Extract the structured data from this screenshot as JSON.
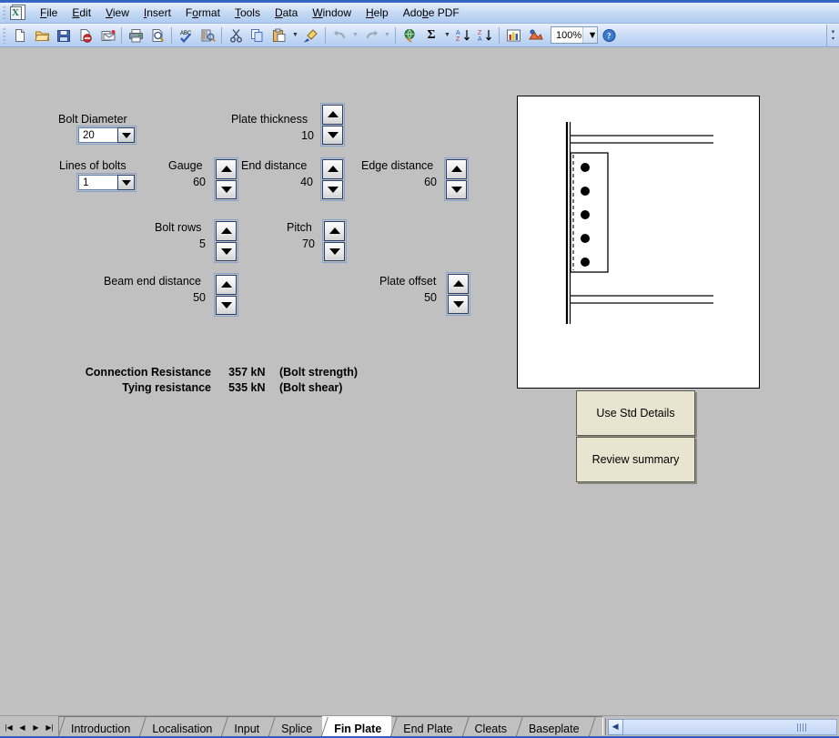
{
  "app": {
    "icon": "excel-icon",
    "menus": [
      {
        "label": "File",
        "accel": "F"
      },
      {
        "label": "Edit",
        "accel": "E"
      },
      {
        "label": "View",
        "accel": "V"
      },
      {
        "label": "Insert",
        "accel": "I"
      },
      {
        "label": "Format",
        "accel": "o"
      },
      {
        "label": "Tools",
        "accel": "T"
      },
      {
        "label": "Data",
        "accel": "D"
      },
      {
        "label": "Window",
        "accel": "W"
      },
      {
        "label": "Help",
        "accel": "H"
      },
      {
        "label": "Adobe PDF",
        "accel": "b"
      }
    ]
  },
  "toolbar": {
    "zoom_value": "100%",
    "buttons": [
      {
        "name": "new-icon"
      },
      {
        "name": "open-icon"
      },
      {
        "name": "save-icon"
      },
      {
        "name": "permission-icon"
      },
      {
        "name": "email-icon"
      },
      {
        "name": "print-icon"
      },
      {
        "name": "print-preview-icon"
      },
      {
        "name": "spelling-icon"
      },
      {
        "name": "research-icon"
      },
      {
        "name": "cut-icon"
      },
      {
        "name": "copy-icon"
      },
      {
        "name": "paste-icon"
      },
      {
        "name": "format-painter-icon"
      },
      {
        "name": "undo-icon"
      },
      {
        "name": "redo-icon"
      },
      {
        "name": "hyperlink-icon"
      },
      {
        "name": "autosum-icon"
      },
      {
        "name": "sort-ascending-icon"
      },
      {
        "name": "sort-descending-icon"
      },
      {
        "name": "chart-wizard-icon"
      },
      {
        "name": "drawing-icon"
      },
      {
        "name": "help-icon"
      }
    ]
  },
  "form": {
    "bolt_diameter": {
      "label": "Bolt Diameter",
      "value": "20"
    },
    "lines_of_bolts": {
      "label": "Lines of bolts",
      "value": "1"
    },
    "plate_thickness": {
      "label": "Plate thickness",
      "value": "10"
    },
    "gauge": {
      "label": "Gauge",
      "value": "60"
    },
    "end_distance": {
      "label": "End distance",
      "value": "40"
    },
    "edge_distance": {
      "label": "Edge distance",
      "value": "60"
    },
    "bolt_rows": {
      "label": "Bolt rows",
      "value": "5"
    },
    "pitch": {
      "label": "Pitch",
      "value": "70"
    },
    "beam_end_distance": {
      "label": "Beam end distance",
      "value": "50"
    },
    "plate_offset": {
      "label": "Plate offset",
      "value": "50"
    }
  },
  "results": [
    {
      "label": "Connection Resistance",
      "value": "357 kN",
      "note": "(Bolt strength)"
    },
    {
      "label": "Tying resistance",
      "value": "535 kN",
      "note": "(Bolt shear)"
    }
  ],
  "actions": [
    {
      "label": "Use Std Details",
      "name": "use-std-details-button"
    },
    {
      "label": "Review summary",
      "name": "review-summary-button"
    }
  ],
  "diagram": {
    "name": "fin-plate-connection-diagram",
    "bolt_count": 5,
    "description": "Fin plate connection elevation: column face, beam flanges, fin plate with dashed weld line and bolt row"
  },
  "sheet_tabs": {
    "tabs": [
      {
        "label": "Introduction",
        "active": false
      },
      {
        "label": "Localisation",
        "active": false
      },
      {
        "label": "Input",
        "active": false
      },
      {
        "label": "Splice",
        "active": false
      },
      {
        "label": "Fin Plate",
        "active": true
      },
      {
        "label": "End Plate",
        "active": false
      },
      {
        "label": "Cleats",
        "active": false
      },
      {
        "label": "Baseplate",
        "active": false
      }
    ],
    "nav": [
      "first-sheet",
      "prev-sheet",
      "next-sheet",
      "last-sheet"
    ]
  },
  "colors": {
    "background": "#c0c0c0",
    "button_face": "#e8e4d0",
    "accent_blue": "#2f5fba"
  }
}
